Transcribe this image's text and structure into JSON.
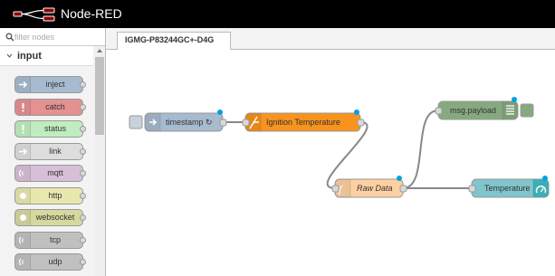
{
  "header": {
    "title": "Node-RED"
  },
  "palette": {
    "filter_placeholder": "filter nodes",
    "category": "input",
    "nodes": [
      {
        "label": "inject",
        "color": "#a6bbcf"
      },
      {
        "label": "catch",
        "color": "#e49191"
      },
      {
        "label": "status",
        "color": "#c0edc0"
      },
      {
        "label": "link",
        "color": "#dddddd"
      },
      {
        "label": "mqtt",
        "color": "#d8bfd8"
      },
      {
        "label": "http",
        "color": "#e7e7ae"
      },
      {
        "label": "websocket",
        "color": "#d7d7a0"
      },
      {
        "label": "tcp",
        "color": "#c0c0c0"
      },
      {
        "label": "udp",
        "color": "#c0c0c0"
      }
    ]
  },
  "tabs": [
    {
      "label": "IGMG-P83244GC+-D4G",
      "active": true
    }
  ],
  "flow": {
    "nodes": {
      "timestamp": {
        "label": "timestamp ↻",
        "color": "#a6bbcf",
        "icon": "inject-icon"
      },
      "ignition": {
        "label": "Ignition Temperature",
        "color": "#f7931e",
        "icon": "change-icon"
      },
      "raw": {
        "label": "Raw Data",
        "color": "#fdd0a2",
        "icon": "function-icon"
      },
      "payload": {
        "label": "msg.payload",
        "color": "#87a980",
        "icon": "debug-icon"
      },
      "temperature": {
        "label": "Temperature",
        "color": "#3fadb5",
        "icon": "gauge-icon"
      }
    },
    "changed_badge_color": "#00a1e5"
  }
}
